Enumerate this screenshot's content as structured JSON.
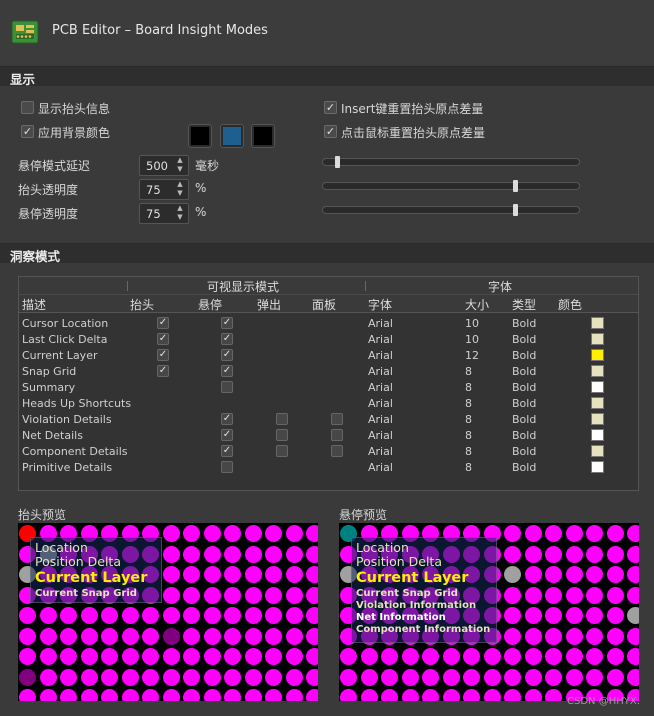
{
  "window": {
    "title": "PCB Editor – Board Insight Modes",
    "icon": "pcb-board-icon"
  },
  "display": {
    "section_title": "显示",
    "show_heads_up": {
      "label": "显示抬头信息",
      "checked": false
    },
    "apply_background_color": {
      "label": "应用背景颜色",
      "checked": true
    },
    "insert_reset_delta": {
      "label": "Insert键重置抬头原点差量",
      "checked": true
    },
    "click_reset_delta": {
      "label": "点击鼠标重置抬头原点差量",
      "checked": true
    },
    "background_colors": [
      "#000000",
      "#1f5f8f",
      "#000000"
    ],
    "hover_delay": {
      "label": "悬停模式延迟",
      "value": "500",
      "unit": "毫秒",
      "slider": 0.04
    },
    "heads_up_opacity": {
      "label": "抬头透明度",
      "value": "75",
      "unit": "%",
      "slider": 0.75
    },
    "hover_opacity": {
      "label": "悬停透明度",
      "value": "75",
      "unit": "%",
      "slider": 0.75
    }
  },
  "insight": {
    "section_title": "洞察模式",
    "group_visible": "可视显示模式",
    "group_font": "字体",
    "columns": {
      "desc": "描述",
      "heads_up": "抬头",
      "hover": "悬停",
      "popup": "弹出",
      "panel": "面板",
      "font": "字体",
      "size": "大小",
      "style": "类型",
      "color": "颜色"
    },
    "rows": [
      {
        "desc": "Cursor Location",
        "heads_up": true,
        "hover": true,
        "popup": null,
        "panel": null,
        "font": "Arial",
        "size": "10",
        "style": "Bold",
        "color": "#e6e2bf"
      },
      {
        "desc": "Last Click Delta",
        "heads_up": true,
        "hover": true,
        "popup": null,
        "panel": null,
        "font": "Arial",
        "size": "10",
        "style": "Bold",
        "color": "#e6e2bf"
      },
      {
        "desc": "Current Layer",
        "heads_up": true,
        "hover": true,
        "popup": null,
        "panel": null,
        "font": "Arial",
        "size": "12",
        "style": "Bold",
        "color": "#ffee00"
      },
      {
        "desc": "Snap Grid",
        "heads_up": true,
        "hover": true,
        "popup": null,
        "panel": null,
        "font": "Arial",
        "size": "8",
        "style": "Bold",
        "color": "#e6e2bf"
      },
      {
        "desc": "Summary",
        "heads_up": null,
        "hover": false,
        "popup": null,
        "panel": null,
        "font": "Arial",
        "size": "8",
        "style": "Bold",
        "color": "#ffffff"
      },
      {
        "desc": "Heads Up Shortcuts",
        "heads_up": null,
        "hover": null,
        "popup": null,
        "panel": null,
        "font": "Arial",
        "size": "8",
        "style": "Bold",
        "color": "#e6e2bf"
      },
      {
        "desc": "Violation Details",
        "heads_up": null,
        "hover": true,
        "popup": false,
        "panel": false,
        "font": "Arial",
        "size": "8",
        "style": "Bold",
        "color": "#e6e2bf"
      },
      {
        "desc": "Net Details",
        "heads_up": null,
        "hover": true,
        "popup": false,
        "panel": false,
        "font": "Arial",
        "size": "8",
        "style": "Bold",
        "color": "#ffffff"
      },
      {
        "desc": "Component Details",
        "heads_up": null,
        "hover": true,
        "popup": false,
        "panel": false,
        "font": "Arial",
        "size": "8",
        "style": "Bold",
        "color": "#e6e2bf"
      },
      {
        "desc": "Primitive Details",
        "heads_up": null,
        "hover": false,
        "popup": null,
        "panel": null,
        "font": "Arial",
        "size": "8",
        "style": "Bold",
        "color": "#ffffff"
      }
    ]
  },
  "preview": {
    "heads_up_label": "抬头预览",
    "hover_label": "悬停预览",
    "lines": {
      "location": "Location",
      "position_delta": "Position Delta",
      "current_layer": "Current Layer",
      "snap_grid": "Current Snap Grid",
      "violation": "Violation Information",
      "net": "Net Information",
      "component": "Component Information"
    }
  },
  "watermark": "CSDN @HHYX."
}
